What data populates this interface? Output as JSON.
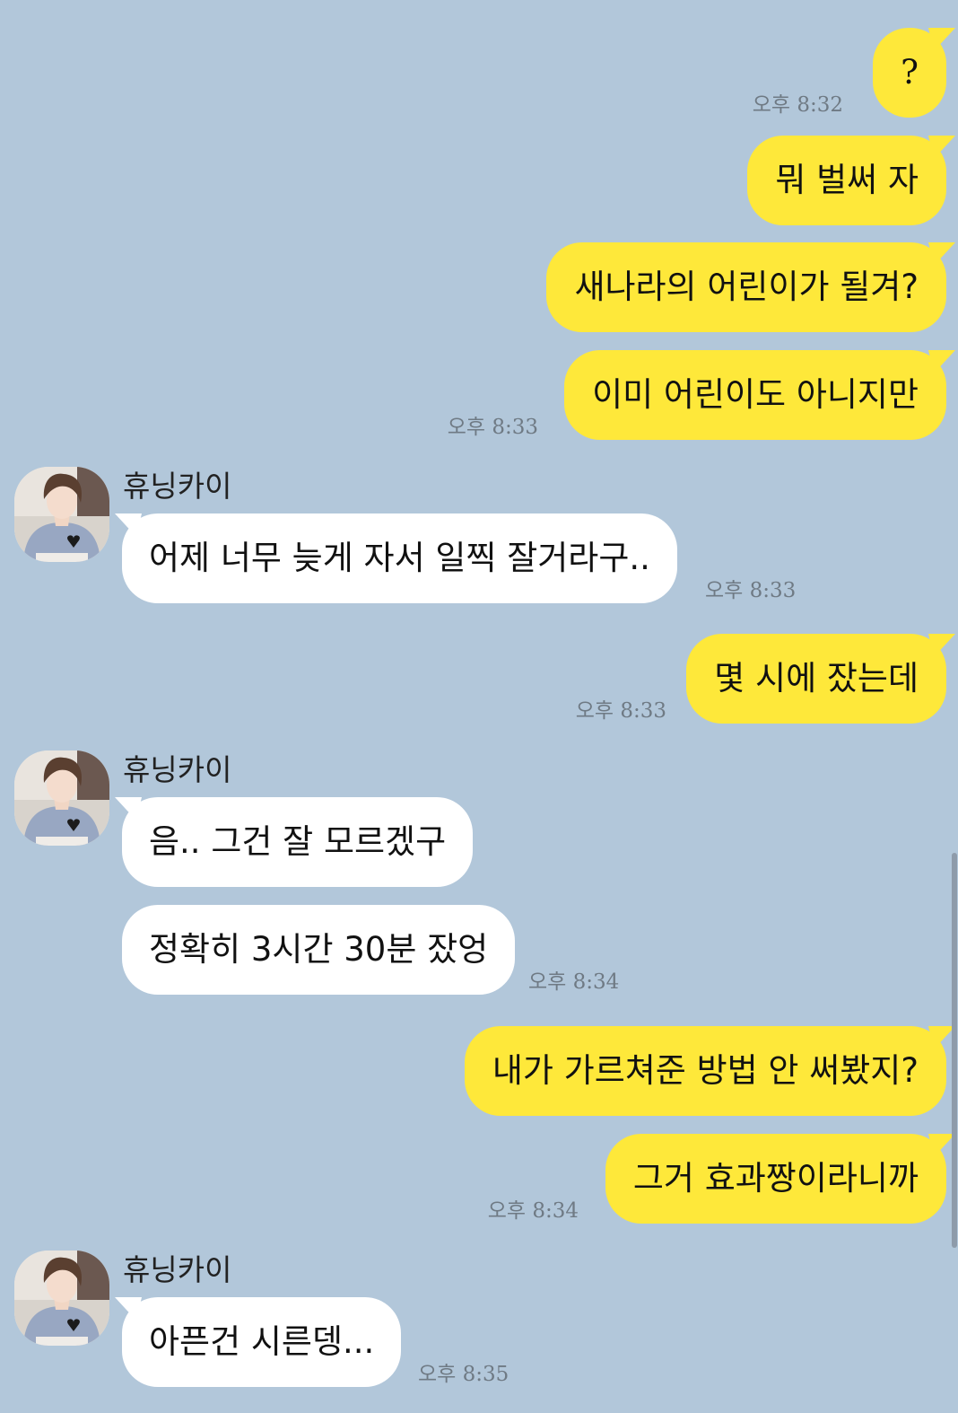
{
  "contact": {
    "name": "휴닝카이",
    "avatar_icon": "profile-photo"
  },
  "colors": {
    "background": "#b2c7da",
    "my_bubble": "#fee83a",
    "their_bubble": "#ffffff",
    "timestamp": "#6f7a84"
  },
  "messages": [
    {
      "sender": "me",
      "text": "?",
      "time": "오후 8:32"
    },
    {
      "sender": "me",
      "text": "뭐 벌써 자",
      "time": ""
    },
    {
      "sender": "me",
      "text": "새나라의 어린이가 될겨?",
      "time": ""
    },
    {
      "sender": "me",
      "text": "이미 어린이도 아니지만",
      "time": "오후 8:33"
    },
    {
      "sender": "them",
      "text": "어제 너무 늦게 자서 일찍 잘거라구..",
      "time": "오후 8:33"
    },
    {
      "sender": "me",
      "text": "몇 시에 잤는데",
      "time": "오후 8:33"
    },
    {
      "sender": "them",
      "text": "음.. 그건 잘 모르겠구",
      "time": ""
    },
    {
      "sender": "them",
      "text": "정확히 3시간 30분 잤엉",
      "time": "오후 8:34"
    },
    {
      "sender": "me",
      "text": "내가 가르쳐준 방법 안 써봤지?",
      "time": ""
    },
    {
      "sender": "me",
      "text": "그거 효과짱이라니까",
      "time": "오후 8:34"
    },
    {
      "sender": "them",
      "text": "아픈건 시른뎅...",
      "time": "오후 8:35"
    }
  ]
}
